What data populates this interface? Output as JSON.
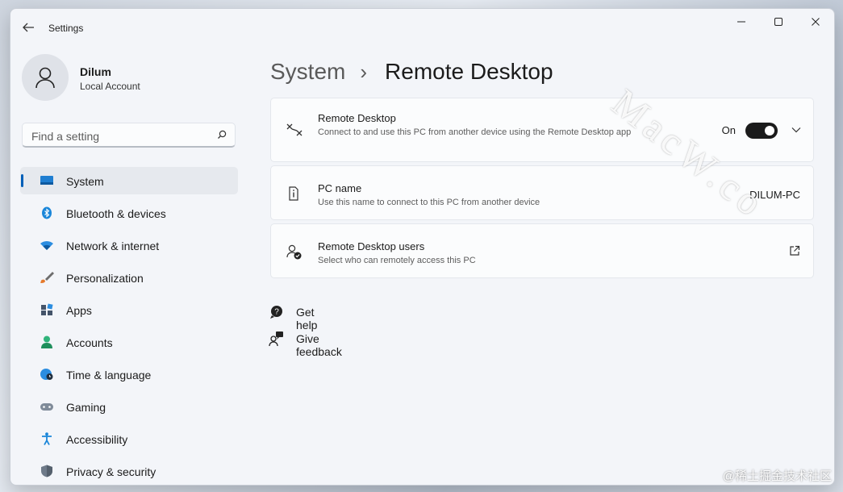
{
  "window": {
    "app_title": "Settings"
  },
  "profile": {
    "name": "Dilum",
    "account_type": "Local Account"
  },
  "search": {
    "placeholder": "Find a setting"
  },
  "sidebar": {
    "items": [
      {
        "label": "System",
        "icon": "system-icon",
        "active": true
      },
      {
        "label": "Bluetooth & devices",
        "icon": "bluetooth-icon"
      },
      {
        "label": "Network & internet",
        "icon": "wifi-icon"
      },
      {
        "label": "Personalization",
        "icon": "brush-icon"
      },
      {
        "label": "Apps",
        "icon": "apps-icon"
      },
      {
        "label": "Accounts",
        "icon": "accounts-icon"
      },
      {
        "label": "Time & language",
        "icon": "globe-clock-icon"
      },
      {
        "label": "Gaming",
        "icon": "gamepad-icon"
      },
      {
        "label": "Accessibility",
        "icon": "accessibility-icon"
      },
      {
        "label": "Privacy & security",
        "icon": "shield-icon"
      }
    ]
  },
  "breadcrumb": {
    "parent": "System",
    "separator": "›",
    "current": "Remote Desktop"
  },
  "cards": {
    "remote_desktop": {
      "title": "Remote Desktop",
      "description": "Connect to and use this PC from another device using the Remote Desktop app",
      "toggle_label": "On",
      "toggle_on": true
    },
    "pc_name": {
      "title": "PC name",
      "description": "Use this name to connect to this PC from another device",
      "value": "DILUM-PC"
    },
    "remote_users": {
      "title": "Remote Desktop users",
      "description": "Select who can remotely access this PC"
    }
  },
  "help": {
    "get_help": "Get help",
    "give_feedback": "Give feedback"
  },
  "watermarks": {
    "diagonal": "MacW.co",
    "corner": "@稀土掘金技术社区"
  },
  "colors": {
    "accent": "#005fb8",
    "window_bg": "#f3f5f9",
    "card_bg": "#fbfcfd"
  }
}
